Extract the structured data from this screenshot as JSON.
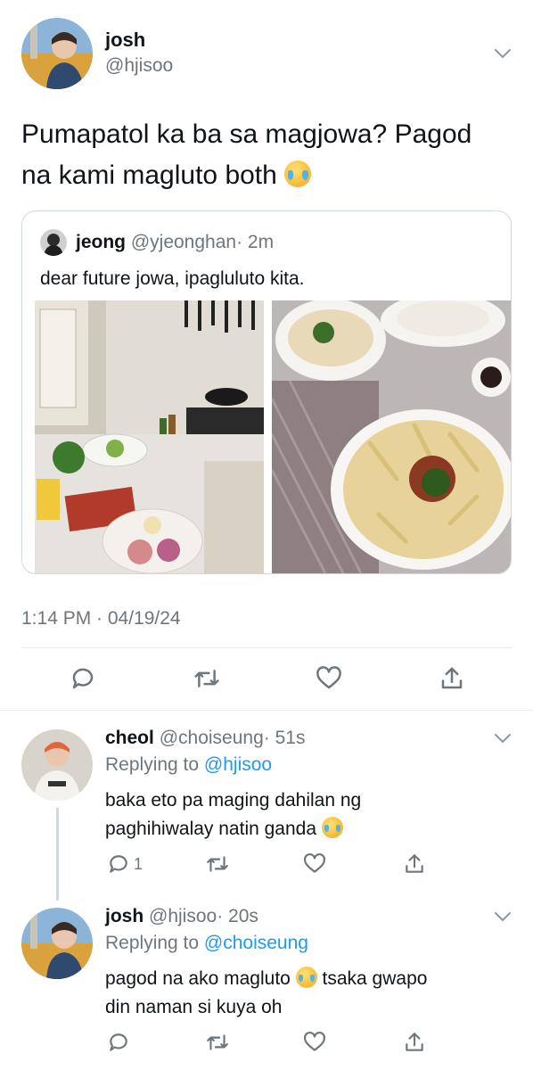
{
  "main_tweet": {
    "display_name": "josh",
    "handle": "@hjisoo",
    "text_line1": "Pumapatol ka ba sa magjowa? Pagod",
    "text_line2": "na kami magluto both",
    "emoji": "crying-face",
    "timestamp": "1:14 PM · 04/19/24",
    "quote": {
      "display_name": "jeong",
      "handle": "@yjeonghan",
      "time": "· 2m",
      "text": "dear future jowa, ipagluluto kita."
    }
  },
  "replies": [
    {
      "display_name": "cheol",
      "handle": "@choiseung",
      "time": "· 51s",
      "replying_label": "Replying to",
      "replying_to": "@hjisoo",
      "text_line1": "baka eto pa maging dahilan ng",
      "text_line2": "paghihiwalay natin ganda",
      "reply_count": "1"
    },
    {
      "display_name": "josh",
      "handle": "@hjisoo",
      "time": "· 20s",
      "replying_label": "Replying to",
      "replying_to": "@choiseung",
      "text_line1a": "pagod na ako magluto",
      "text_line1b": "tsaka gwapo",
      "text_line2": "din naman si kuya oh"
    }
  ],
  "colors": {
    "link": "#1d9bf0",
    "secondary": "#6e767d",
    "divider": "#e6ecf0"
  }
}
